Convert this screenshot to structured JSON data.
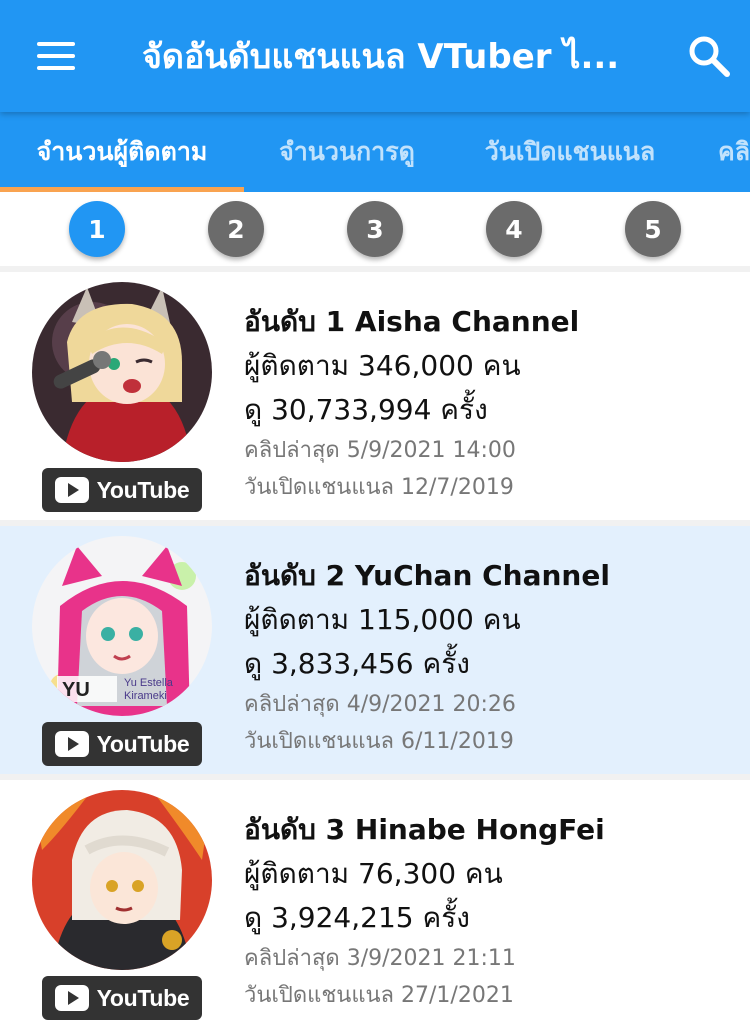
{
  "app": {
    "title": "จัดอันดับแชนแนล VTuber ไ...",
    "menu_icon": "hamburger-menu-icon",
    "search_icon": "search-icon",
    "primary_color": "#2196F3",
    "accent_color": "#F9A350"
  },
  "tabs": [
    {
      "label": "จำนวนผู้ติดตาม",
      "active": true
    },
    {
      "label": "จำนวนการดู",
      "active": false
    },
    {
      "label": "วันเปิดแชนแนล",
      "active": false
    },
    {
      "label": "คลิ",
      "active": false
    }
  ],
  "pages": [
    "1",
    "2",
    "3",
    "4",
    "5"
  ],
  "current_page": "1",
  "channels": [
    {
      "rank": "อันดับ 1 Aisha Channel",
      "subscribers": "ผู้ติดตาม 346,000 คน",
      "views": "ดู 30,733,994 ครั้ง",
      "last_clip": "คลิปล่าสุด 5/9/2021 14:00",
      "opened": "วันเปิดแชนแนล 12/7/2019",
      "badge": "YouTube",
      "highlight": false
    },
    {
      "rank": "อันดับ 2 YuChan Channel",
      "subscribers": "ผู้ติดตาม 115,000 คน",
      "views": "ดู 3,833,456 ครั้ง",
      "last_clip": "คลิปล่าสุด 4/9/2021 20:26",
      "opened": "วันเปิดแชนแนล 6/11/2019",
      "badge": "YouTube",
      "highlight": true
    },
    {
      "rank": "อันดับ 3 Hinabe HongFei",
      "subscribers": "ผู้ติดตาม 76,300 คน",
      "views": "ดู 3,924,215 ครั้ง",
      "last_clip": "คลิปล่าสุด 3/9/2021 21:11",
      "opened": "วันเปิดแชนแนล 27/1/2021",
      "badge": "YouTube",
      "highlight": false
    }
  ]
}
